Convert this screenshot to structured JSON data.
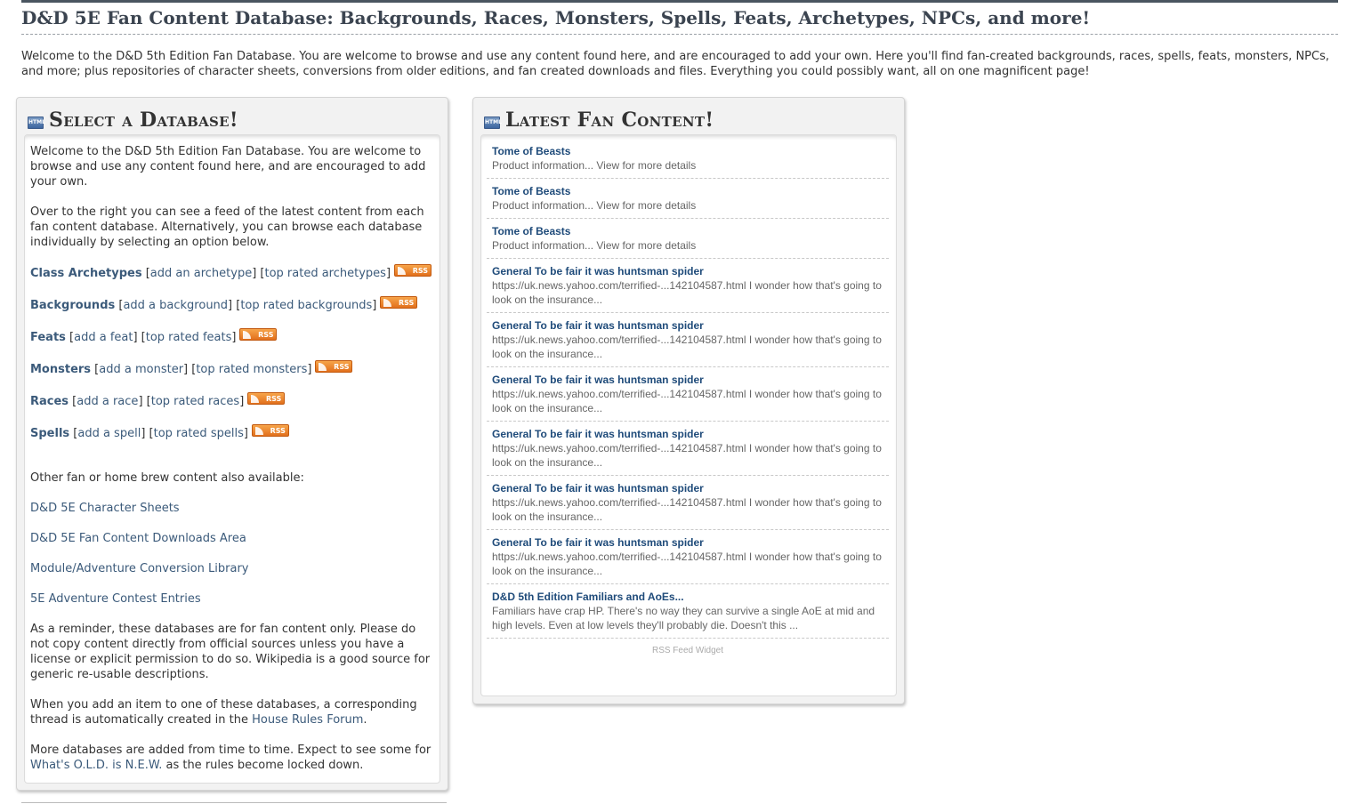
{
  "page": {
    "title": "D&D 5E Fan Content Database: Backgrounds, Races, Monsters, Spells, Feats, Archetypes, NPCs, and more!",
    "intro": "Welcome to the D&D 5th Edition Fan Database. You are welcome to browse and use any content found here, and are encouraged to add your own. Here you'll find fan-created backgrounds, races, spells, feats, monsters, NPCs, and more; plus repositories of character sheets, conversions from older editions, and fan created downloads and files. Everything you could possibly want, all on one magnificent page!"
  },
  "left_panel": {
    "icon": "html-icon",
    "title": "Select a Database!",
    "welcome": "Welcome to the D&D 5th Edition Fan Database. You are welcome to browse and use any content found here, and are encouraged to add your own.",
    "feed_note": "Over to the right you can see a feed of the latest content from each fan content database.  Alternatively, you can browse each database individually by selecting an option below.",
    "rss_label": "RSS",
    "databases": [
      {
        "name": "Class Archetypes",
        "add": "add an archetype",
        "top": "top rated archetypes"
      },
      {
        "name": "Backgrounds",
        "add": "add a background",
        "top": "top rated backgrounds"
      },
      {
        "name": "Feats",
        "add": "add a feat",
        "top": "top rated feats"
      },
      {
        "name": "Monsters",
        "add": "add a monster",
        "top": "top rated monsters"
      },
      {
        "name": "Races",
        "add": "add a race",
        "top": "top rated races"
      },
      {
        "name": "Spells",
        "add": "add a spell",
        "top": "top rated spells"
      }
    ],
    "other_heading": "Other fan or home brew content also available:",
    "other_links": [
      "D&D 5E Character Sheets",
      "D&D 5E Fan Content Downloads Area",
      "Module/Adventure Conversion Library",
      "5E Adventure Contest Entries"
    ],
    "reminder": "As a reminder, these databases are for fan content only.  Please do not copy content directly from official sources unless you have a license or explicit permission to do so. Wikipedia is a good source for generic re-usable descriptions.",
    "thread_note_pre": "When you add an item to one of these databases, a corresponding thread is automatically created in the ",
    "thread_note_link": "House Rules Forum",
    "thread_note_post": ".",
    "more_pre": "More databases are added from time to time. Expect to see some for ",
    "more_link": "What's O.L.D. is N.E.W.",
    "more_post": " as the rules become locked down."
  },
  "right_panel": {
    "icon": "html-icon",
    "title": "Latest Fan Content!",
    "items": [
      {
        "title": "Tome of Beasts",
        "desc": "Product information... View for more details"
      },
      {
        "title": "Tome of Beasts",
        "desc": "Product information... View for more details"
      },
      {
        "title": "Tome of Beasts",
        "desc": "Product information... View for more details"
      },
      {
        "title": "General To be fair it was huntsman spider",
        "desc": "https://uk.news.yahoo.com/terrified-...142104587.html I wonder how that's going to look on the insurance..."
      },
      {
        "title": "General To be fair it was huntsman spider",
        "desc": "https://uk.news.yahoo.com/terrified-...142104587.html I wonder how that's going to look on the insurance..."
      },
      {
        "title": "General To be fair it was huntsman spider",
        "desc": "https://uk.news.yahoo.com/terrified-...142104587.html I wonder how that's going to look on the insurance..."
      },
      {
        "title": "General To be fair it was huntsman spider",
        "desc": "https://uk.news.yahoo.com/terrified-...142104587.html I wonder how that's going to look on the insurance..."
      },
      {
        "title": "General To be fair it was huntsman spider",
        "desc": "https://uk.news.yahoo.com/terrified-...142104587.html I wonder how that's going to look on the insurance..."
      },
      {
        "title": "General To be fair it was huntsman spider",
        "desc": "https://uk.news.yahoo.com/terrified-...142104587.html I wonder how that's going to look on the insurance..."
      },
      {
        "title": "D&D 5th Edition Familiars and AoEs...",
        "desc": "Familiars have crap HP. There's no way they can survive a single AoE at mid and high levels. Even at low levels they'll probably die. Doesn't this ..."
      }
    ],
    "footer": "RSS Feed Widget"
  }
}
